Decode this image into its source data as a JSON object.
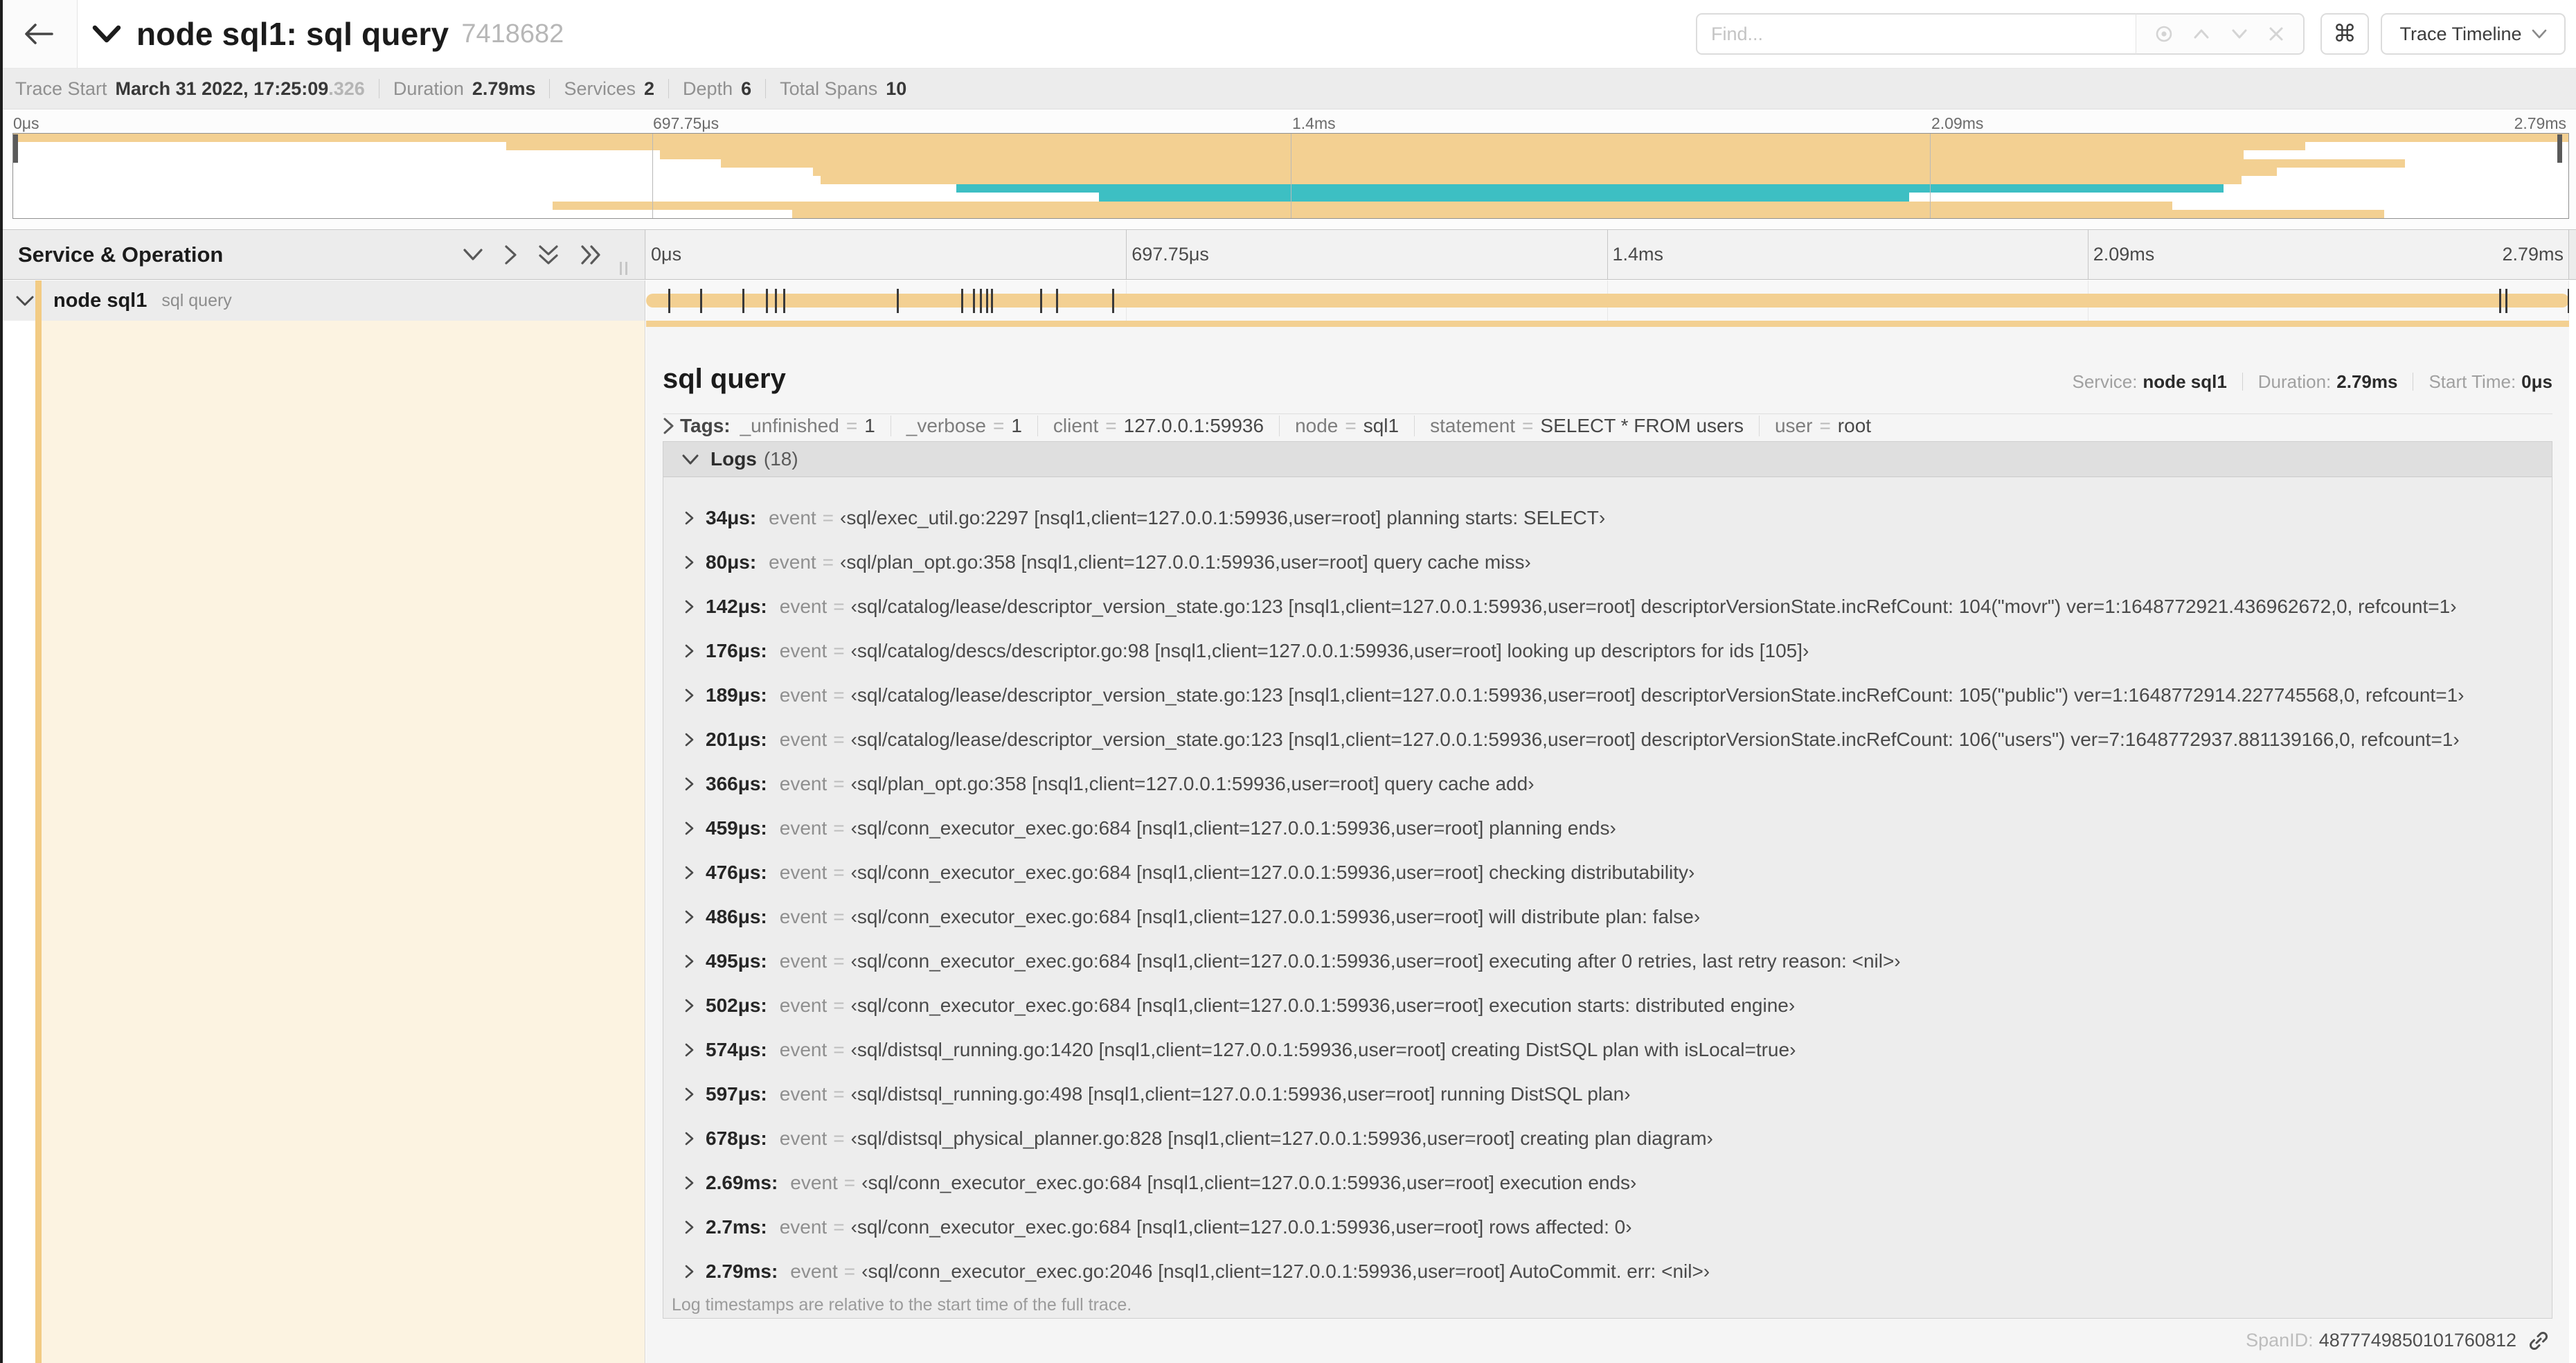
{
  "colors": {
    "tan": "#F3D092",
    "tan_deep": "#F2CB84",
    "teal": "#3DBFC3",
    "cream": "#FCF3E1"
  },
  "header": {
    "title": "node sql1: sql query",
    "trace_id_short": "7418682",
    "find_placeholder": "Find...",
    "command_key": "⌘",
    "view_selector_label": "Trace Timeline"
  },
  "summary": {
    "trace_start_label": "Trace Start",
    "trace_start_value": "March 31 2022, 17:25:09",
    "trace_start_ms": ".326",
    "duration_label": "Duration",
    "duration_value": "2.79ms",
    "services_label": "Services",
    "services_value": "2",
    "depth_label": "Depth",
    "depth_value": "6",
    "total_spans_label": "Total Spans",
    "total_spans_value": "10"
  },
  "minimap": {
    "tick_labels": [
      "0μs",
      "697.75μs",
      "1.4ms",
      "2.09ms",
      "2.79ms"
    ],
    "spans": [
      {
        "start": 0.0,
        "end": 1.0,
        "color": "tan"
      },
      {
        "start": 0.193,
        "end": 0.897,
        "color": "tan"
      },
      {
        "start": 0.253,
        "end": 0.873,
        "color": "tan"
      },
      {
        "start": 0.277,
        "end": 0.936,
        "color": "tan"
      },
      {
        "start": 0.313,
        "end": 0.886,
        "color": "tan"
      },
      {
        "start": 0.316,
        "end": 0.872,
        "color": "tan"
      },
      {
        "start": 0.369,
        "end": 0.865,
        "color": "teal"
      },
      {
        "start": 0.425,
        "end": 0.742,
        "color": "teal"
      },
      {
        "start": 0.211,
        "end": 0.845,
        "color": "tan"
      },
      {
        "start": 0.305,
        "end": 0.928,
        "color": "tan"
      }
    ]
  },
  "timeline": {
    "column_header": "Service & Operation",
    "tick_labels": [
      "0μs",
      "697.75μs",
      "1.4ms",
      "2.09ms",
      "2.79ms"
    ],
    "row": {
      "service": "node sql1",
      "operation": "sql query"
    },
    "log_marker_fractions": [
      0.0122,
      0.0287,
      0.0509,
      0.0631,
      0.0677,
      0.072,
      0.1312,
      0.1645,
      0.1706,
      0.1742,
      0.1774,
      0.1799,
      0.2057,
      0.214,
      0.243,
      0.9642,
      0.9677,
      1.0
    ]
  },
  "detail": {
    "title": "sql query",
    "meta": [
      {
        "label": "Service:",
        "value": "node sql1"
      },
      {
        "label": "Duration:",
        "value": "2.79ms"
      },
      {
        "label": "Start Time:",
        "value": "0μs"
      }
    ],
    "tags_label": "Tags:",
    "tags": [
      {
        "key": "_unfinished",
        "value": "1"
      },
      {
        "key": "_verbose",
        "value": "1"
      },
      {
        "key": "client",
        "value": "127.0.0.1:59936"
      },
      {
        "key": "node",
        "value": "sql1"
      },
      {
        "key": "statement",
        "value": "SELECT * FROM users"
      },
      {
        "key": "user",
        "value": "root"
      }
    ],
    "logs_label": "Logs",
    "logs_count": "(18)",
    "logs": [
      {
        "time": "34μs:",
        "field": "event",
        "value": "‹sql/exec_util.go:2297 [nsql1,client=127.0.0.1:59936,user=root] planning starts: SELECT›"
      },
      {
        "time": "80μs:",
        "field": "event",
        "value": "‹sql/plan_opt.go:358 [nsql1,client=127.0.0.1:59936,user=root] query cache miss›"
      },
      {
        "time": "142μs:",
        "field": "event",
        "value": "‹sql/catalog/lease/descriptor_version_state.go:123 [nsql1,client=127.0.0.1:59936,user=root] descriptorVersionState.incRefCount: 104(\"movr\") ver=1:1648772921.436962672,0, refcount=1›"
      },
      {
        "time": "176μs:",
        "field": "event",
        "value": "‹sql/catalog/descs/descriptor.go:98 [nsql1,client=127.0.0.1:59936,user=root] looking up descriptors for ids [105]›"
      },
      {
        "time": "189μs:",
        "field": "event",
        "value": "‹sql/catalog/lease/descriptor_version_state.go:123 [nsql1,client=127.0.0.1:59936,user=root] descriptorVersionState.incRefCount: 105(\"public\") ver=1:1648772914.227745568,0, refcount=1›"
      },
      {
        "time": "201μs:",
        "field": "event",
        "value": "‹sql/catalog/lease/descriptor_version_state.go:123 [nsql1,client=127.0.0.1:59936,user=root] descriptorVersionState.incRefCount: 106(\"users\") ver=7:1648772937.881139166,0, refcount=1›"
      },
      {
        "time": "366μs:",
        "field": "event",
        "value": "‹sql/plan_opt.go:358 [nsql1,client=127.0.0.1:59936,user=root] query cache add›"
      },
      {
        "time": "459μs:",
        "field": "event",
        "value": "‹sql/conn_executor_exec.go:684 [nsql1,client=127.0.0.1:59936,user=root] planning ends›"
      },
      {
        "time": "476μs:",
        "field": "event",
        "value": "‹sql/conn_executor_exec.go:684 [nsql1,client=127.0.0.1:59936,user=root] checking distributability›"
      },
      {
        "time": "486μs:",
        "field": "event",
        "value": "‹sql/conn_executor_exec.go:684 [nsql1,client=127.0.0.1:59936,user=root] will distribute plan: false›"
      },
      {
        "time": "495μs:",
        "field": "event",
        "value": "‹sql/conn_executor_exec.go:684 [nsql1,client=127.0.0.1:59936,user=root] executing after 0 retries, last retry reason: <nil>›"
      },
      {
        "time": "502μs:",
        "field": "event",
        "value": "‹sql/conn_executor_exec.go:684 [nsql1,client=127.0.0.1:59936,user=root] execution starts: distributed engine›"
      },
      {
        "time": "574μs:",
        "field": "event",
        "value": "‹sql/distsql_running.go:1420 [nsql1,client=127.0.0.1:59936,user=root] creating DistSQL plan with isLocal=true›"
      },
      {
        "time": "597μs:",
        "field": "event",
        "value": "‹sql/distsql_running.go:498 [nsql1,client=127.0.0.1:59936,user=root] running DistSQL plan›"
      },
      {
        "time": "678μs:",
        "field": "event",
        "value": "‹sql/distsql_physical_planner.go:828 [nsql1,client=127.0.0.1:59936,user=root] creating plan diagram›"
      },
      {
        "time": "2.69ms:",
        "field": "event",
        "value": "‹sql/conn_executor_exec.go:684 [nsql1,client=127.0.0.1:59936,user=root] execution ends›"
      },
      {
        "time": "2.7ms:",
        "field": "event",
        "value": "‹sql/conn_executor_exec.go:684 [nsql1,client=127.0.0.1:59936,user=root] rows affected: 0›"
      },
      {
        "time": "2.79ms:",
        "field": "event",
        "value": "‹sql/conn_executor_exec.go:2046 [nsql1,client=127.0.0.1:59936,user=root] AutoCommit. err: <nil>›"
      }
    ],
    "logs_footnote": "Log timestamps are relative to the start time of the full trace.",
    "span_id_label": "SpanID:",
    "span_id_value": "4877749850101760812"
  }
}
